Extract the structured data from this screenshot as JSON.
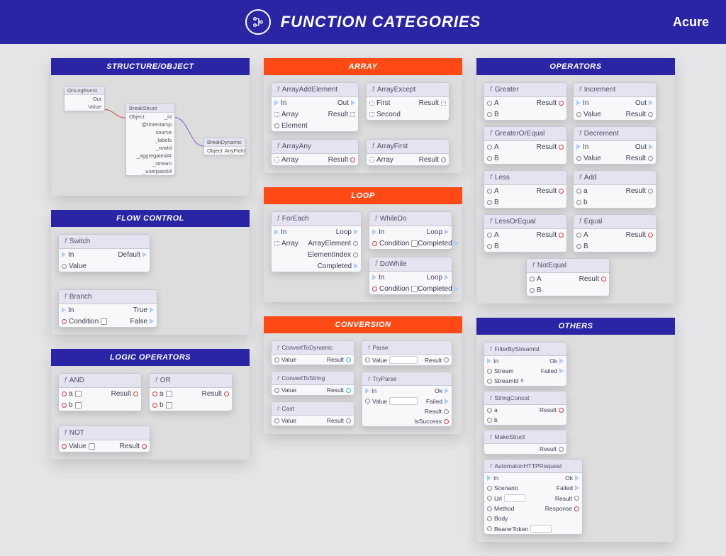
{
  "header": {
    "title": "FUNCTION CATEGORIES",
    "brand": "Acure"
  },
  "categories": {
    "structure": {
      "label": "STRUCTURE/OBJECT",
      "color": "blue",
      "mini": {
        "onlog": {
          "title": "OnLogEvent",
          "out": "Out",
          "value": "Value"
        },
        "breakstruct": {
          "title": "BreakStruct",
          "obj": "Object",
          "fields": [
            "_id",
            "@timestamp",
            "source",
            "_labels",
            "_rowId",
            "_aggregatedAt",
            "_stream",
            "_userpassId"
          ]
        },
        "breakdyn": {
          "title": "BreakDynamic",
          "obj": "Object",
          "any": "AnyField"
        }
      }
    },
    "flow": {
      "label": "FLOW CONTROL",
      "color": "blue",
      "nodes": {
        "switch": {
          "title": "Switch",
          "in": "In",
          "default": "Default",
          "value": "Value"
        },
        "branch": {
          "title": "Branch",
          "in": "In",
          "true": "True",
          "cond": "Condition",
          "false": "False"
        }
      }
    },
    "logic": {
      "label": "LOGIC OPERATORS",
      "color": "blue",
      "nodes": {
        "and": {
          "title": "AND",
          "a": "a",
          "b": "b",
          "result": "Result"
        },
        "or": {
          "title": "OR",
          "a": "a",
          "b": "b",
          "result": "Result"
        },
        "not": {
          "title": "NOT",
          "value": "Value",
          "result": "Result"
        }
      }
    },
    "array": {
      "label": "ARRAY",
      "color": "orange",
      "nodes": {
        "add": {
          "title": "ArrayAddElement",
          "in": "In",
          "out": "Out",
          "array": "Array",
          "result": "Result",
          "element": "Element"
        },
        "except": {
          "title": "ArrayExcept",
          "first": "First",
          "result": "Result",
          "second": "Second"
        },
        "any": {
          "title": "ArrayAny",
          "array": "Array",
          "result": "Result"
        },
        "first": {
          "title": "ArrayFirst",
          "array": "Array",
          "result": "Result"
        }
      }
    },
    "loop": {
      "label": "LOOP",
      "color": "orange",
      "nodes": {
        "foreach": {
          "title": "ForEach",
          "in": "In",
          "loop": "Loop",
          "array": "Array",
          "ae": "ArrayElement",
          "ei": "ElementIndex",
          "comp": "Completed"
        },
        "whiledo": {
          "title": "WhileDo",
          "in": "In",
          "loop": "Loop",
          "cond": "Condition",
          "comp": "Completed"
        },
        "dowhile": {
          "title": "DoWhile",
          "in": "In",
          "loop": "Loop",
          "cond": "Condition",
          "comp": "Completed"
        }
      }
    },
    "conversion": {
      "label": "CONVERSION",
      "color": "orange",
      "nodes": {
        "todyn": {
          "title": "ConvertToDynamic",
          "value": "Value",
          "result": "Result"
        },
        "parse": {
          "title": "Parse",
          "value": "Value",
          "result": "Result"
        },
        "tostr": {
          "title": "ConvertToString",
          "value": "Value",
          "result": "Result"
        },
        "tryparse": {
          "title": "TryParse",
          "in": "In",
          "ok": "Ok",
          "value": "Value",
          "failed": "Failed",
          "result": "Result",
          "iss": "IsSuccess"
        },
        "cast": {
          "title": "Cast",
          "value": "Value",
          "result": "Result"
        }
      }
    },
    "operators": {
      "label": "OPERATORS",
      "color": "blue",
      "nodes": {
        "greater": {
          "title": "Greater",
          "a": "A",
          "b": "B",
          "result": "Result"
        },
        "increment": {
          "title": "Increment",
          "in": "In",
          "out": "Out",
          "value": "Value",
          "result": "Result"
        },
        "goe": {
          "title": "GreaterOrEqual",
          "a": "A",
          "b": "B",
          "result": "Result"
        },
        "decrement": {
          "title": "Decrement",
          "in": "In",
          "out": "Out",
          "value": "Value",
          "result": "Result"
        },
        "less": {
          "title": "Less",
          "a": "A",
          "b": "B",
          "result": "Result"
        },
        "add": {
          "title": "Add",
          "a": "a",
          "b": "b",
          "result": "Result"
        },
        "loe": {
          "title": "LessOrEqual",
          "a": "A",
          "b": "B",
          "result": "Result"
        },
        "equal": {
          "title": "Equal",
          "a": "A",
          "b": "B",
          "result": "Result"
        },
        "notequal": {
          "title": "NotEqual",
          "a": "A",
          "b": "B",
          "result": "Result"
        }
      }
    },
    "others": {
      "label": "OTHERS",
      "color": "blue",
      "nodes": {
        "fbs": {
          "title": "FilterByStreamId",
          "in": "In",
          "ok": "Ok",
          "stream": "Stream",
          "failed": "Failed",
          "sid": "StreamId"
        },
        "ahr": {
          "title": "AutomatonHTTPRequest",
          "in": "In",
          "ok": "Ok",
          "scenario": "Scenario",
          "failed": "Failed",
          "url": "Url",
          "result": "Result",
          "method": "Method",
          "response": "Response",
          "body": "Body",
          "bearer": "BearerToken"
        },
        "sc": {
          "title": "StringConcat",
          "a": "a",
          "b": "b",
          "result": "Result"
        },
        "ms": {
          "title": "MakeStruct",
          "result": "Result"
        }
      }
    }
  }
}
